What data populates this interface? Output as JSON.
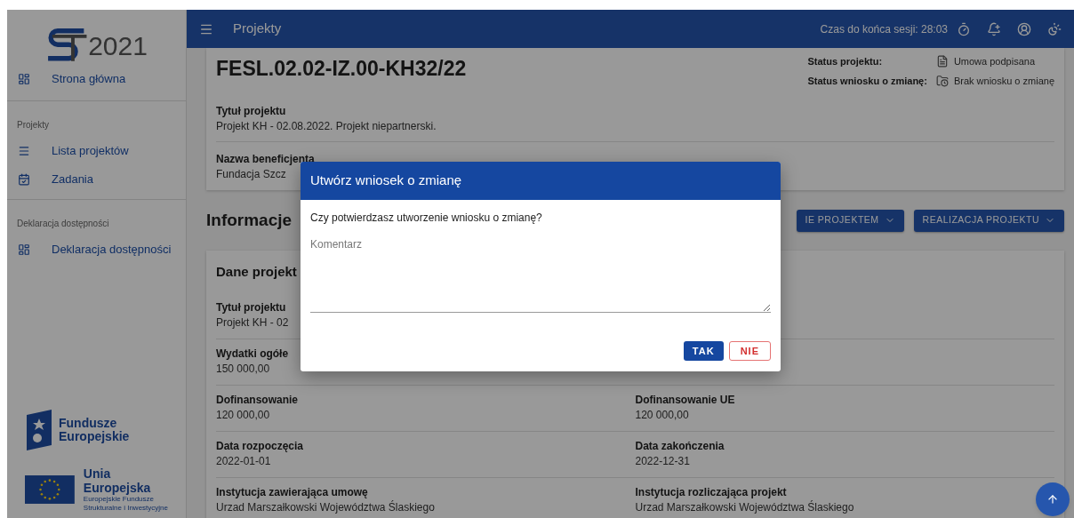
{
  "app_bar": {
    "title": "Projekty",
    "session": "Czas do końca sesji: 28:03"
  },
  "sidebar": {
    "logo_year": "2021",
    "home": {
      "label": "Strona główna"
    },
    "sections": [
      {
        "title": "Projekty",
        "items": [
          {
            "label": "Lista projektów"
          },
          {
            "label": "Zadania"
          }
        ]
      },
      {
        "title": "Deklaracja dostępności",
        "items": [
          {
            "label": "Deklaracja dostępności"
          }
        ]
      }
    ],
    "funds_logo": [
      "Fundusze",
      "Europejskie"
    ],
    "eu_logo": {
      "title": "Unia Europejska",
      "lines": [
        "Europejskie Fundusze",
        "Strukturalne i Inwestycyjne"
      ]
    }
  },
  "project": {
    "number": "FESL.02.02-IZ.00-KH32/22",
    "statuses": [
      {
        "label": "Status projektu:",
        "value": "Umowa podpisana"
      },
      {
        "label": "Status wniosku o zmianę:",
        "value": "Brak wniosku o zmianę"
      }
    ],
    "fields": [
      {
        "label": "Tytuł projektu",
        "value": "Projekt KH - 02.08.2022. Projekt niepartnerski."
      },
      {
        "label": "Nazwa beneficjenta",
        "value": "Fundacja Szcz"
      }
    ]
  },
  "info": {
    "heading": "Informacje",
    "buttons": [
      "IE PROJEKTEM",
      "REALIZACJA PROJEKTU"
    ]
  },
  "details": {
    "heading": "Dane projekt",
    "rows": [
      {
        "left": {
          "label": "Tytuł projektu",
          "value": "Projekt KH - 02"
        }
      },
      {
        "left": {
          "label": "Wydatki ogółe",
          "value": "150 000,00"
        }
      },
      {
        "left": {
          "label": "Dofinansowanie",
          "value": "120 000,00"
        },
        "right": {
          "label": "Dofinansowanie UE",
          "value": "120 000,00"
        }
      },
      {
        "left": {
          "label": "Data rozpoczęcia",
          "value": "2022-01-01"
        },
        "right": {
          "label": "Data zakończenia",
          "value": "2022-12-31"
        }
      },
      {
        "left": {
          "label": "Instytucja zawierająca umowę",
          "value": "Urzad Marszałkowski Województwa Ślaskiego"
        },
        "right": {
          "label": "Instytucja rozliczająca projekt",
          "value": "Urzad Marszałkowski Województwa Ślaskiego"
        }
      }
    ]
  },
  "dialog": {
    "title": "Utwórz wniosek o zmianę",
    "question": "Czy potwierdzasz utworzenie wniosku o zmianę?",
    "placeholder": "Komentarz",
    "confirm": "TAK",
    "cancel": "NIE"
  }
}
